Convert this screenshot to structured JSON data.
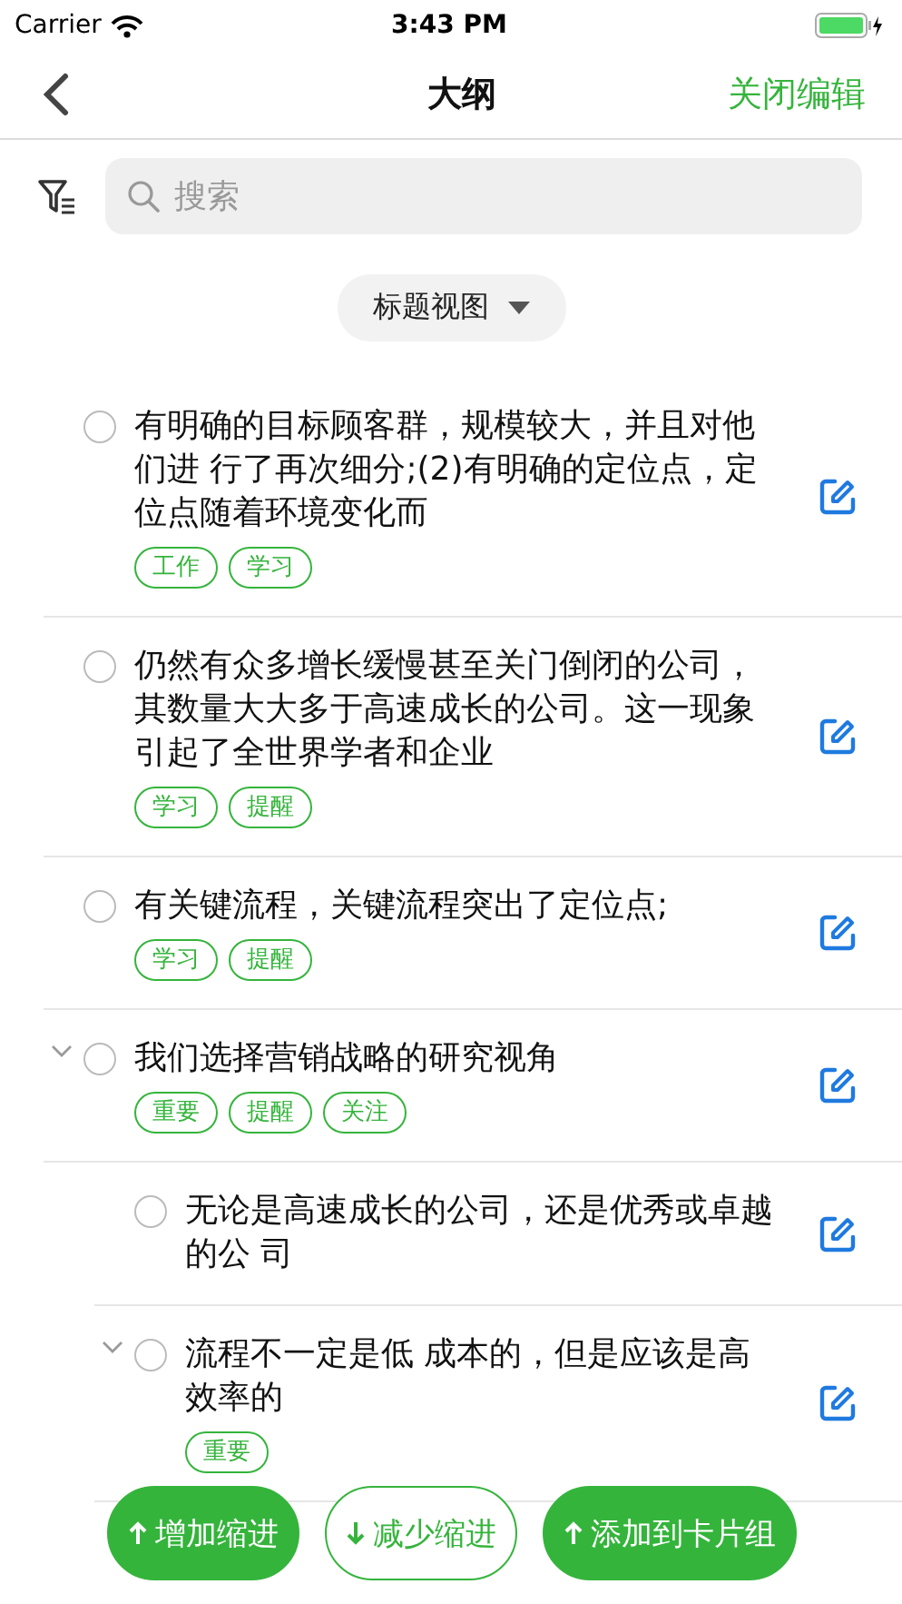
{
  "status_bar": {
    "carrier": "Carrier",
    "time": "3:43 PM"
  },
  "nav": {
    "title": "大纲",
    "action": "关闭编辑"
  },
  "search": {
    "placeholder": "搜索"
  },
  "view_selector": {
    "label": "标题视图"
  },
  "items": [
    {
      "text": "有明确的目标顾客群，规模较大，并且对他们进 行了再次细分;(2)有明确的定位点，定位点随着环境变化而",
      "checked": false,
      "tags": [
        "工作",
        "学习"
      ]
    },
    {
      "text": "仍然有众多增长缓慢甚至关门倒闭的公司，其数量大大多于高速成长的公司。这一现象引起了全世界学者和企业",
      "checked": false,
      "tags": [
        "学习",
        "提醒"
      ]
    },
    {
      "text": "有关键流程，关键流程突出了定位点;",
      "checked": false,
      "tags": [
        "学习",
        "提醒"
      ]
    },
    {
      "text": "我们选择营销战略的研究视角",
      "checked": false,
      "expanded": true,
      "tags": [
        "重要",
        "提醒",
        "关注"
      ],
      "children": [
        {
          "text": "无论是高速成长的公司，还是优秀或卓越的公 司",
          "checked": false
        },
        {
          "text": "流程不一定是低 成本的，但是应该是高效率的",
          "checked": false,
          "expanded": true,
          "tags": [
            "重要"
          ]
        }
      ]
    }
  ],
  "actions": [
    {
      "label": "增加缩进",
      "kind": "filled"
    },
    {
      "label": "减少缩进",
      "kind": "outline"
    },
    {
      "label": "添加到卡片组",
      "kind": "filled"
    }
  ]
}
